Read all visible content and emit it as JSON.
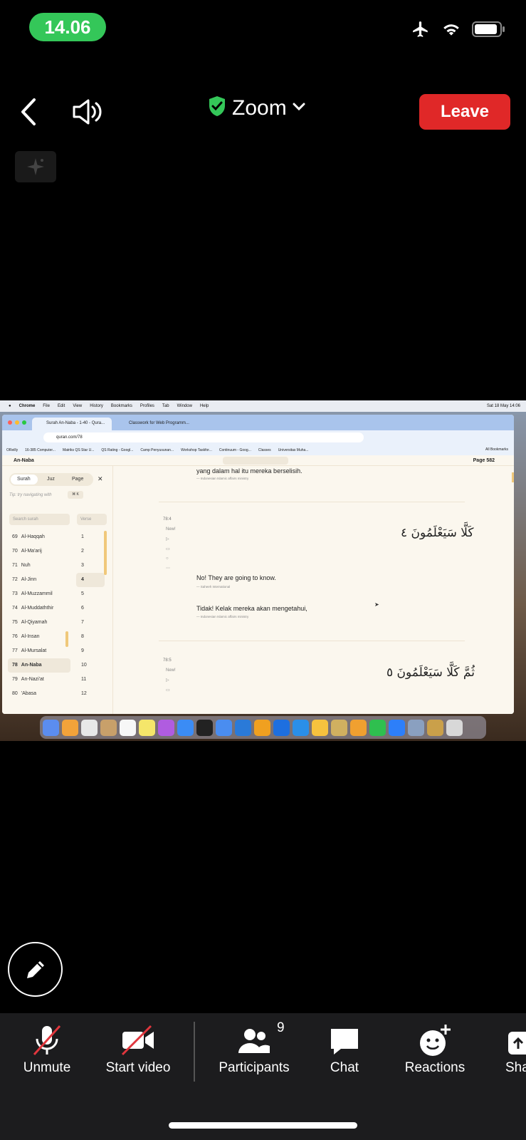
{
  "status_bar": {
    "time": "14.06",
    "icons": [
      "airplane-icon",
      "wifi-icon",
      "battery-icon"
    ]
  },
  "header": {
    "title": "Zoom",
    "leave_label": "Leave",
    "secure_color": "#34c759",
    "leave_color": "#e02828"
  },
  "shared_screen": {
    "mac_menubar": {
      "app": "Chrome",
      "menus": [
        "File",
        "Edit",
        "View",
        "History",
        "Bookmarks",
        "Profiles",
        "Tab",
        "Window",
        "Help"
      ],
      "clock": "Sat 18 May 14:06"
    },
    "browser": {
      "tabs": [
        "Surah An-Naba - 1-40 - Qura...",
        "Classwork for Web Programm..."
      ],
      "url": "quran.com/78",
      "bookmarks": [
        "OReilly",
        "16-385 Computer...",
        "Matriks QS Star U...",
        "QS Rating - Googl...",
        "Camp Penyusunan...",
        "Workshop Taskfor...",
        "Continuum - Goog...",
        "Classes",
        "Universitas Muha..."
      ],
      "all_bookmarks": "All Bookmarks"
    },
    "quran": {
      "current_surah": "An-Naba",
      "page_label": "Page 582",
      "nav_tabs": [
        "Surah",
        "Juz",
        "Page"
      ],
      "tip": "Tip: try navigating with",
      "shortcut": "⌘ K",
      "search_surah_placeholder": "Search surah",
      "search_verse_placeholder": "Verse",
      "surahs": [
        {
          "num": "69",
          "name": "Al-Haqqah"
        },
        {
          "num": "70",
          "name": "Al-Ma'arij"
        },
        {
          "num": "71",
          "name": "Nuh"
        },
        {
          "num": "72",
          "name": "Al-Jinn"
        },
        {
          "num": "73",
          "name": "Al-Muzzammil"
        },
        {
          "num": "74",
          "name": "Al-Muddaththir"
        },
        {
          "num": "75",
          "name": "Al-Qiyamah"
        },
        {
          "num": "76",
          "name": "Al-Insan"
        },
        {
          "num": "77",
          "name": "Al-Mursalat"
        },
        {
          "num": "78",
          "name": "An-Naba"
        },
        {
          "num": "79",
          "name": "An-Nazi'at"
        },
        {
          "num": "80",
          "name": "'Abasa"
        }
      ],
      "verses": [
        "1",
        "2",
        "3",
        "4",
        "5",
        "6",
        "7",
        "8",
        "9",
        "10",
        "11",
        "12"
      ],
      "prev_translation": "yang dalam hal itu mereka berselisih.",
      "prev_source": "— Indonesian Islamic affairs ministry",
      "verse_4": {
        "key": "78:4",
        "new_label": "New!",
        "arabic": "كَلَّا سَيَعْلَمُونَ ٤",
        "english": "No! They are going to know.",
        "english_source": "— Saheeh International",
        "indonesian": "Tidak! Kelak mereka akan mengetahui,",
        "indonesian_source": "— Indonesian Islamic affairs ministry"
      },
      "verse_5": {
        "key": "78:5",
        "new_label": "New!",
        "arabic": "ثُمَّ كَلَّا سَيَعْلَمُونَ ٥"
      }
    }
  },
  "toolbar": {
    "unmute": "Unmute",
    "start_video": "Start video",
    "participants": "Participants",
    "participants_count": "9",
    "chat": "Chat",
    "reactions": "Reactions",
    "share": "Sha"
  }
}
